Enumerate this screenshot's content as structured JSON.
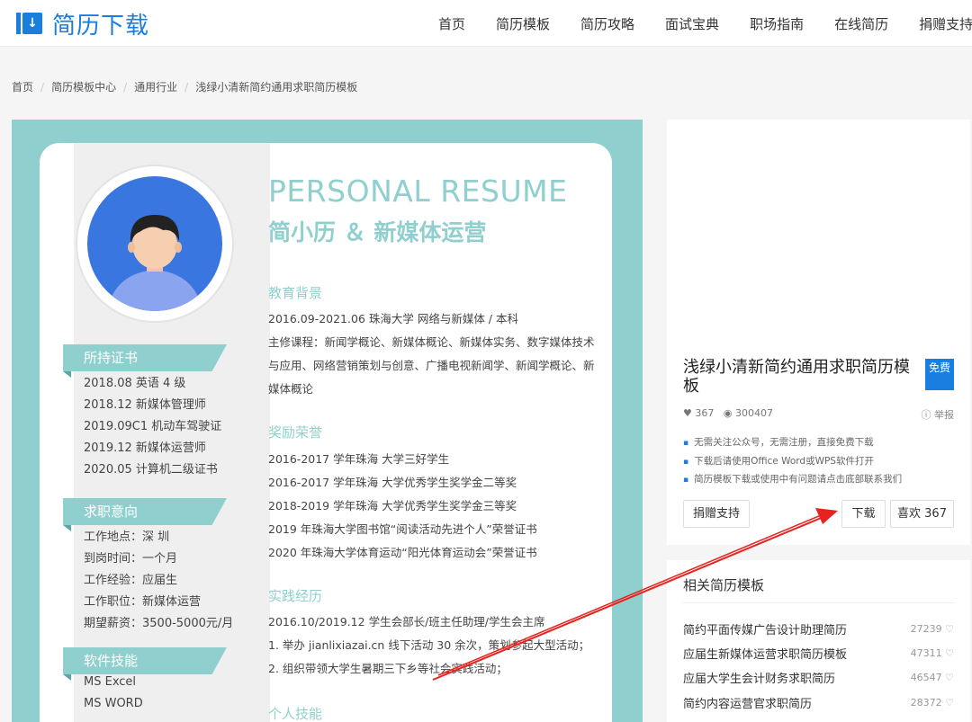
{
  "header": {
    "logo_text": "简历下载",
    "nav": [
      "首页",
      "简历模板",
      "简历攻略",
      "面试宝典",
      "职场指南",
      "在线简历",
      "捐赠支持"
    ]
  },
  "breadcrumb": [
    "首页",
    "简历模板中心",
    "通用行业",
    "浅绿小清新简约通用求职简历模板"
  ],
  "resume": {
    "title_en": "PERSONAL RESUME",
    "title_cn": "简小历 ＆ 新媒体运营",
    "left": {
      "cert_title": "所持证书",
      "certs": [
        "2018.08 英语 4 级",
        "2018.12 新媒体管理师",
        "2019.09C1 机动车驾驶证",
        "2019.12 新媒体运营师",
        "2020.05 计算机二级证书"
      ],
      "intent_title": "求职意向",
      "intents": [
        "工作地点：深 圳",
        "到岗时间：一个月",
        "工作经验：应届生",
        "工作职位：新媒体运营",
        "期望薪资：3500-5000元/月"
      ],
      "skills_title": "软件技能",
      "skills": [
        "MS Excel",
        "MS WORD"
      ]
    },
    "edu_title": "教育背景",
    "edu_lines": [
      "2016.09-2021.06        珠海大学        网络与新媒体  /  本科",
      "主修课程：新闻学概论、新媒体概论、新媒体实务、数字媒体技术",
      "与应用、网络营销策划与创意、广播电视新闻学、新闻学概论、新",
      "媒体概论"
    ],
    "award_title": "奖励荣誉",
    "award_lines": [
      "2016-2017 学年珠海    大学三好学生",
      "2016-2017 学年珠海    大学优秀学生奖学金二等奖",
      "2018-2019 学年珠海    大学优秀学生奖学金三等奖",
      "2019 年珠海大学图书馆“阅读活动先进个人”荣誉证书",
      "2020 年珠海大学体育运动“阳光体育运动会”荣誉证书"
    ],
    "practice_title": "实践经历",
    "practice_lines": [
      "2016.10/2019.12 学生会部长/班主任助理/学生会主席",
      "1. 举办 jianlixiazai.cn 线下活动 30 余次，策划参起大型活动；",
      "2. 组织带领大学生暑期三下乡等社会实践活动；"
    ],
    "skill_title": "个人技能"
  },
  "info": {
    "title": "浅绿小清新简约通用求职简历模板",
    "free_badge": "免费",
    "likes": "367",
    "views": "300407",
    "report": "举报",
    "notes": [
      "无需关注公众号，无需注册，直接免费下载",
      "下载后请使用Office Word或WPS软件打开",
      "简历模板下载或使用中有问题请点击底部联系我们"
    ],
    "donate_btn": "捐赠支持",
    "download_btn": "下载",
    "like_btn": "喜欢 367"
  },
  "related": {
    "title": "相关简历模板",
    "items": [
      {
        "name": "简约平面传媒广告设计助理简历",
        "count": "27239"
      },
      {
        "name": "应届生新媒体运营求职简历模板",
        "count": "47311"
      },
      {
        "name": "应届大学生会计财务求职简历",
        "count": "46547"
      },
      {
        "name": "简约内容运营官求职简历",
        "count": "28372"
      }
    ]
  },
  "colors": {
    "accent": "#1a7de0",
    "mint": "#8fd0cf",
    "arrow": "#e8231f"
  }
}
